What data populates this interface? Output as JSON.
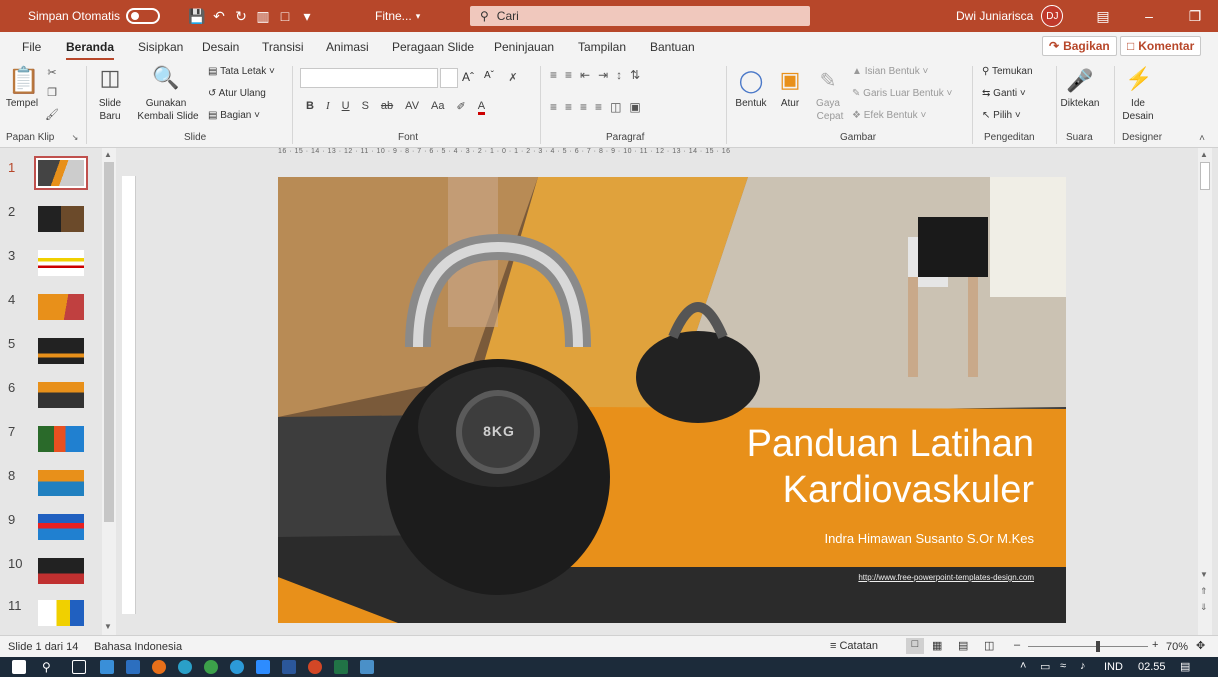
{
  "titlebar": {
    "autosave_label": "Simpan Otomatis",
    "file_name": "Fitne...",
    "search_placeholder": "Cari",
    "user_name": "Dwi Juniarisca",
    "user_initials": "DJ",
    "accent_color": "#b7472a"
  },
  "tabs": [
    "File",
    "Beranda",
    "Sisipkan",
    "Desain",
    "Transisi",
    "Animasi",
    "Peragaan Slide",
    "Peninjauan",
    "Tampilan",
    "Bantuan"
  ],
  "active_tab": "Beranda",
  "share_label": "Bagikan",
  "comment_label": "Komentar",
  "ribbon": {
    "clipboard": {
      "paste": "Tempel",
      "group": "Papan Klip"
    },
    "slides": {
      "new_slide": "Slide",
      "new_slide2": "Baru",
      "reuse": "Gunakan",
      "reuse2": "Kembali Slide",
      "layout": "Tata Letak",
      "reset": "Atur Ulang",
      "section": "Bagian",
      "group": "Slide"
    },
    "font": {
      "group": "Font",
      "bold": "B",
      "italic": "I",
      "underline": "U",
      "strike": "S",
      "spacing": "AV",
      "case": "Aa",
      "grow": "A",
      "shrink": "A"
    },
    "paragraph": {
      "group": "Paragraf"
    },
    "drawing": {
      "shapes": "Bentuk",
      "arrange": "Atur",
      "quick_styles": "Gaya",
      "quick_styles2": "Cepat",
      "fill": "Isian Bentuk",
      "outline": "Garis Luar Bentuk",
      "effects": "Efek Bentuk",
      "group": "Gambar"
    },
    "editing": {
      "find": "Temukan",
      "replace": "Ganti",
      "select": "Pilih",
      "group": "Pengeditan"
    },
    "voice": {
      "dictate": "Diktekan",
      "group": "Suara"
    },
    "designer": {
      "ideas": "Ide",
      "ideas2": "Desain",
      "group": "Designer"
    }
  },
  "slides_panel": {
    "numbers": [
      "1",
      "2",
      "3",
      "4",
      "5",
      "6",
      "7",
      "8",
      "9",
      "10",
      "11"
    ],
    "selected": "1"
  },
  "ruler_text": "16 · 15 · 14 · 13 · 12 · 11 · 10 · 9 · 8 · 7 · 6 · 5 · 4 · 3 · 2 · 1 · 0 · 1 · 2 · 3 · 4 · 5 · 6 · 7 · 8 · 9 · 10 · 11 · 12 · 13 · 14 · 15 · 16",
  "slide": {
    "title_line1": "Panduan Latihan",
    "title_line2": "Kardiovaskuler",
    "author": "Indra Himawan Susanto S.Or M.Kes",
    "url": "http://www.free-powerpoint-templates-design.com",
    "kettlebell_label": "8KG",
    "orange": "#e8901a"
  },
  "status": {
    "slide_info": "Slide 1 dari 14",
    "language": "Bahasa Indonesia",
    "notes": "Catatan",
    "zoom": "70%"
  },
  "taskbar": {
    "lang": "IND",
    "time": "02.55"
  }
}
